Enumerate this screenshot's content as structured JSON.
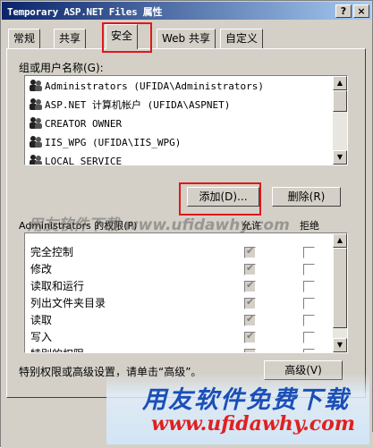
{
  "window": {
    "title": "Temporary ASP.NET Files 属性",
    "help_btn": "?",
    "close_btn": "×"
  },
  "tabs": [
    "常规",
    "共享",
    "安全",
    "Web 共享",
    "自定义"
  ],
  "active_tab": "安全",
  "users_section": {
    "label": "组或用户名称(G):",
    "users": [
      "Administrators (UFIDA\\Administrators)",
      "ASP.NET 计算机帐户 (UFIDA\\ASPNET)",
      "CREATOR OWNER",
      "IIS_WPG (UFIDA\\IIS_WPG)",
      "LOCAL SERVICE"
    ]
  },
  "buttons": {
    "add": "添加(D)...",
    "remove": "删除(R)",
    "advanced": "高级(V)"
  },
  "permissions_section": {
    "label": "Administrators 的权限(P)",
    "col_allow": "允许",
    "col_deny": "拒绝",
    "items": [
      {
        "name": "完全控制",
        "allow": true,
        "deny": false
      },
      {
        "name": "修改",
        "allow": true,
        "deny": false
      },
      {
        "name": "读取和运行",
        "allow": true,
        "deny": false
      },
      {
        "name": "列出文件夹目录",
        "allow": true,
        "deny": false
      },
      {
        "name": "读取",
        "allow": true,
        "deny": false
      },
      {
        "name": "写入",
        "allow": true,
        "deny": false
      },
      {
        "name": "特别的权限",
        "allow": false,
        "deny": false
      }
    ]
  },
  "advanced_hint": "特别权限或高级设置，请单击“高级”。",
  "watermark": {
    "mid": "用友软件下载  www.ufidawhy.com",
    "line1": "用友软件免费下载",
    "line2": "www.ufidawhy.com"
  },
  "colors": {
    "window_bg": "#d4d0c8",
    "title_start": "#0a246a",
    "highlight_red": "#e01818",
    "watermark_blue": "#1b4fb8"
  }
}
